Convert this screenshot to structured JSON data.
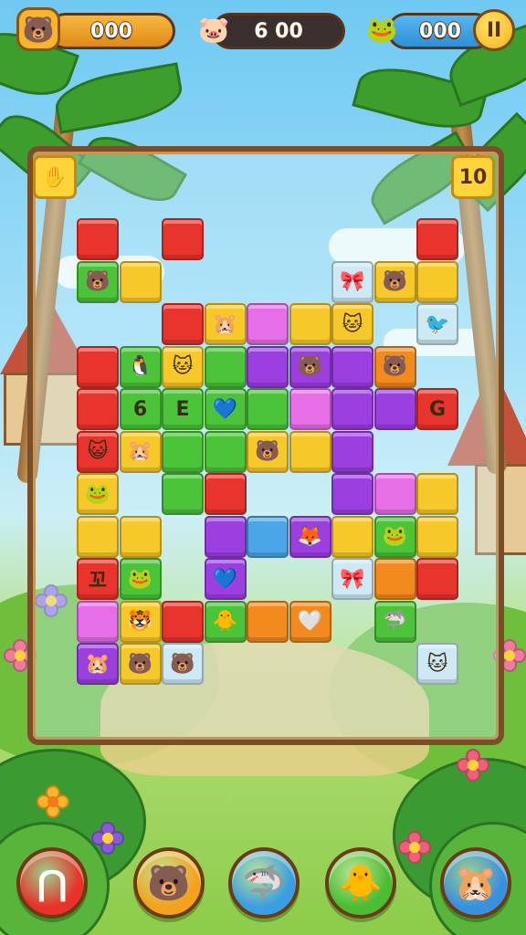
{
  "hud": {
    "left_counter": {
      "value": "000",
      "icon": "bear-face-icon",
      "color": "#f0a52a"
    },
    "center_counter": {
      "value": "6 00",
      "icon": "pink-critter-icon",
      "color": "#3a2e2e"
    },
    "right_counter": {
      "value": "000",
      "icon": "frog-face-icon",
      "color": "#3aa2e6"
    },
    "pause_label": "II"
  },
  "board": {
    "top_left_badge": {
      "icon": "hand-icon"
    },
    "top_right_badge": {
      "label": "10"
    },
    "colors": {
      "R": "#e8342c",
      "Y": "#f7c82a",
      "G": "#4cc43a",
      "P": "#9b3fe0",
      "M": "#e66ee6",
      "O": "#f28a1e",
      "B": "#4ba6e8",
      "L": "#cde9f5"
    },
    "tiles": [
      {
        "r": 0,
        "c": 0,
        "k": "R",
        "s": ""
      },
      {
        "r": 0,
        "c": 2,
        "k": "R",
        "s": ""
      },
      {
        "r": 0,
        "c": 8,
        "k": "R",
        "s": ""
      },
      {
        "r": 1,
        "c": 0,
        "k": "G",
        "s": "🐻"
      },
      {
        "r": 1,
        "c": 1,
        "k": "Y",
        "s": ""
      },
      {
        "r": 1,
        "c": 6,
        "k": "L",
        "s": "🎀"
      },
      {
        "r": 1,
        "c": 7,
        "k": "Y",
        "s": "🐻"
      },
      {
        "r": 1,
        "c": 8,
        "k": "Y",
        "s": ""
      },
      {
        "r": 2,
        "c": 2,
        "k": "R",
        "s": ""
      },
      {
        "r": 2,
        "c": 3,
        "k": "Y",
        "s": "🐹"
      },
      {
        "r": 2,
        "c": 4,
        "k": "M",
        "s": ""
      },
      {
        "r": 2,
        "c": 5,
        "k": "Y",
        "s": ""
      },
      {
        "r": 2,
        "c": 6,
        "k": "Y",
        "s": "🐱"
      },
      {
        "r": 2,
        "c": 8,
        "k": "L",
        "s": "🐦"
      },
      {
        "r": 3,
        "c": 0,
        "k": "R",
        "s": ""
      },
      {
        "r": 3,
        "c": 1,
        "k": "G",
        "s": "🐧"
      },
      {
        "r": 3,
        "c": 2,
        "k": "Y",
        "s": "🐱"
      },
      {
        "r": 3,
        "c": 3,
        "k": "G",
        "s": ""
      },
      {
        "r": 3,
        "c": 4,
        "k": "P",
        "s": ""
      },
      {
        "r": 3,
        "c": 5,
        "k": "P",
        "s": "🐻"
      },
      {
        "r": 3,
        "c": 6,
        "k": "P",
        "s": ""
      },
      {
        "r": 3,
        "c": 7,
        "k": "O",
        "s": "🐻"
      },
      {
        "r": 4,
        "c": 0,
        "k": "R",
        "s": ""
      },
      {
        "r": 4,
        "c": 1,
        "k": "G",
        "s": "6"
      },
      {
        "r": 4,
        "c": 2,
        "k": "G",
        "s": "E"
      },
      {
        "r": 4,
        "c": 3,
        "k": "G",
        "s": "💙"
      },
      {
        "r": 4,
        "c": 4,
        "k": "G",
        "s": ""
      },
      {
        "r": 4,
        "c": 5,
        "k": "M",
        "s": ""
      },
      {
        "r": 4,
        "c": 6,
        "k": "P",
        "s": ""
      },
      {
        "r": 4,
        "c": 7,
        "k": "P",
        "s": ""
      },
      {
        "r": 4,
        "c": 8,
        "k": "R",
        "s": "G"
      },
      {
        "r": 5,
        "c": 0,
        "k": "R",
        "s": "😺"
      },
      {
        "r": 5,
        "c": 1,
        "k": "Y",
        "s": "🐹"
      },
      {
        "r": 5,
        "c": 2,
        "k": "G",
        "s": ""
      },
      {
        "r": 5,
        "c": 3,
        "k": "G",
        "s": ""
      },
      {
        "r": 5,
        "c": 4,
        "k": "Y",
        "s": "🐻"
      },
      {
        "r": 5,
        "c": 5,
        "k": "Y",
        "s": ""
      },
      {
        "r": 5,
        "c": 6,
        "k": "P",
        "s": ""
      },
      {
        "r": 6,
        "c": 0,
        "k": "Y",
        "s": "🐸"
      },
      {
        "r": 6,
        "c": 2,
        "k": "G",
        "s": ""
      },
      {
        "r": 6,
        "c": 3,
        "k": "R",
        "s": ""
      },
      {
        "r": 6,
        "c": 6,
        "k": "P",
        "s": ""
      },
      {
        "r": 6,
        "c": 7,
        "k": "M",
        "s": ""
      },
      {
        "r": 6,
        "c": 8,
        "k": "Y",
        "s": ""
      },
      {
        "r": 7,
        "c": 0,
        "k": "Y",
        "s": ""
      },
      {
        "r": 7,
        "c": 1,
        "k": "Y",
        "s": ""
      },
      {
        "r": 7,
        "c": 3,
        "k": "P",
        "s": ""
      },
      {
        "r": 7,
        "c": 4,
        "k": "B",
        "s": ""
      },
      {
        "r": 7,
        "c": 5,
        "k": "P",
        "s": "🦊"
      },
      {
        "r": 7,
        "c": 6,
        "k": "Y",
        "s": ""
      },
      {
        "r": 7,
        "c": 7,
        "k": "G",
        "s": "🐸"
      },
      {
        "r": 7,
        "c": 8,
        "k": "Y",
        "s": ""
      },
      {
        "r": 8,
        "c": 0,
        "k": "R",
        "s": "꼬"
      },
      {
        "r": 8,
        "c": 1,
        "k": "G",
        "s": "🐸"
      },
      {
        "r": 8,
        "c": 3,
        "k": "P",
        "s": "💙"
      },
      {
        "r": 8,
        "c": 6,
        "k": "L",
        "s": "🎀"
      },
      {
        "r": 8,
        "c": 7,
        "k": "O",
        "s": ""
      },
      {
        "r": 8,
        "c": 8,
        "k": "R",
        "s": ""
      },
      {
        "r": 9,
        "c": 0,
        "k": "M",
        "s": ""
      },
      {
        "r": 9,
        "c": 1,
        "k": "Y",
        "s": "🐯"
      },
      {
        "r": 9,
        "c": 2,
        "k": "R",
        "s": ""
      },
      {
        "r": 9,
        "c": 3,
        "k": "G",
        "s": "🐥"
      },
      {
        "r": 9,
        "c": 4,
        "k": "O",
        "s": ""
      },
      {
        "r": 9,
        "c": 5,
        "k": "O",
        "s": "🤍"
      },
      {
        "r": 9,
        "c": 7,
        "k": "G",
        "s": "🦈"
      },
      {
        "r": 10,
        "c": 0,
        "k": "P",
        "s": "🐹"
      },
      {
        "r": 10,
        "c": 1,
        "k": "Y",
        "s": "🐻"
      },
      {
        "r": 10,
        "c": 2,
        "k": "L",
        "s": "🐻"
      },
      {
        "r": 10,
        "c": 8,
        "k": "L",
        "s": "🐱"
      }
    ]
  },
  "powerups": [
    {
      "icon": "magnet-icon",
      "glyph": "⋂",
      "color": "#e8322a"
    },
    {
      "icon": "bear-icon",
      "glyph": "🐻",
      "color": "#f4a21c"
    },
    {
      "icon": "shark-icon",
      "glyph": "🦈",
      "color": "#3b9ee0"
    },
    {
      "icon": "bird-icon",
      "glyph": "🐥",
      "color": "#4bbd34"
    },
    {
      "icon": "hamster-icon",
      "glyph": "🐹",
      "color": "#3b8fe0"
    }
  ]
}
